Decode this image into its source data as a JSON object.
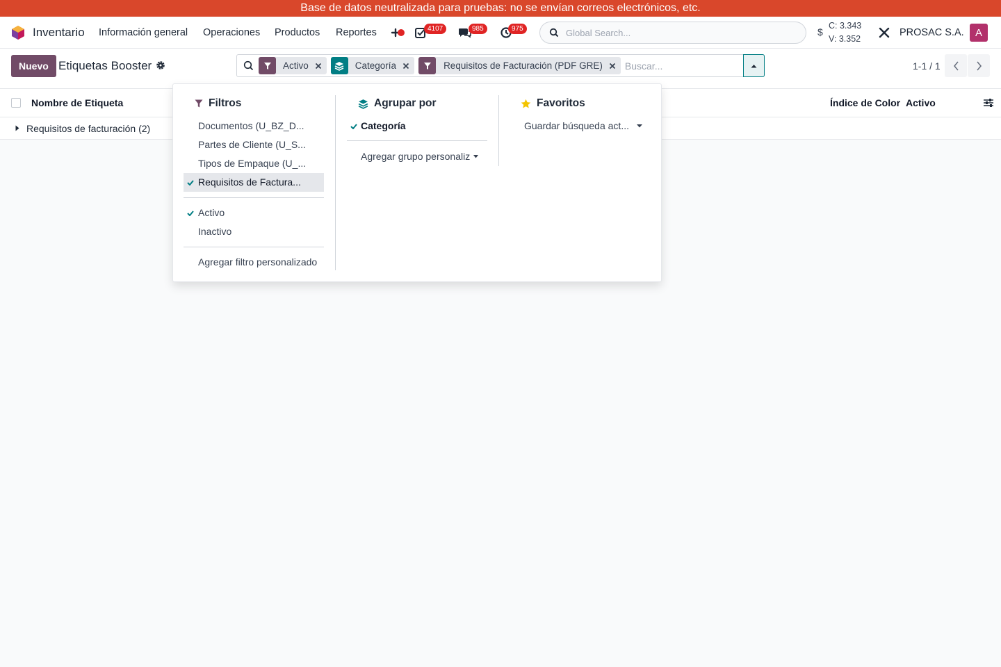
{
  "banner": {
    "text": "Base de datos neutralizada para pruebas: no se envían correos electrónicos, etc."
  },
  "navbar": {
    "app_name": "Inventario",
    "menu": [
      "Información general",
      "Operaciones",
      "Productos",
      "Reportes"
    ],
    "badges": {
      "activities": "4107",
      "messages": "985",
      "timesheets": "975"
    },
    "global_search_placeholder": "Global Search...",
    "currency_sign": "$",
    "rate_buy": "C: 3.343",
    "rate_sell": "V: 3.352",
    "company": "PROSAC S.A.",
    "avatar_letter": "A"
  },
  "control_panel": {
    "new_button": "Nuevo",
    "title": "Etiquetas Booster",
    "facets": {
      "f1": "Activo",
      "f2": "Categoría",
      "f3": "Requisitos de Facturación (PDF GRE)"
    },
    "search_placeholder": "Buscar...",
    "pager": "1-1 / 1"
  },
  "list": {
    "columns": {
      "name": "Nombre de Etiqueta",
      "color": "Índice de Color",
      "active": "Activo"
    },
    "group_label": "Requisitos de facturación (2)"
  },
  "dropdown": {
    "filters": {
      "title": "Filtros",
      "items": [
        "Documentos (U_BZ_D...",
        "Partes de Cliente (U_S...",
        "Tipos de Empaque (U_...",
        "Requisitos de Factura..."
      ],
      "status": [
        "Activo",
        "Inactivo"
      ],
      "custom": "Agregar filtro personalizado"
    },
    "groupby": {
      "title": "Agrupar por",
      "item": "Categoría",
      "custom": "Agregar grupo personaliz"
    },
    "favorites": {
      "title": "Favoritos",
      "save": "Guardar búsqueda act..."
    }
  },
  "colors": {
    "brand": "#714b67",
    "accent": "#017e84",
    "banner": "#d9472b",
    "badge": "#e02424"
  }
}
